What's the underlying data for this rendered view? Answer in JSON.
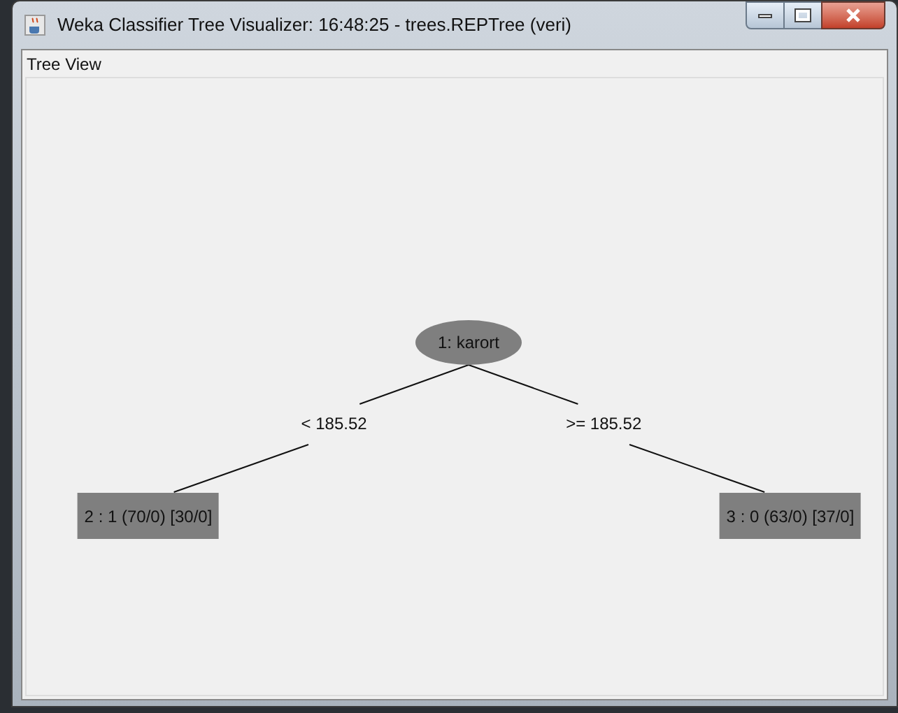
{
  "window": {
    "title": "Weka Classifier Tree Visualizer: 16:48:25 - trees.REPTree (veri)"
  },
  "panel": {
    "title": "Tree View"
  },
  "tree": {
    "label": "1: karort",
    "kind": "oval",
    "children": [
      {
        "edge_label": "< 185.52",
        "node": {
          "label": "2 : 1 (70/0) [30/0]",
          "kind": "box"
        }
      },
      {
        "edge_label": ">= 185.52",
        "node": {
          "label": "3 : 0 (63/0) [37/0]",
          "kind": "box"
        }
      }
    ]
  }
}
